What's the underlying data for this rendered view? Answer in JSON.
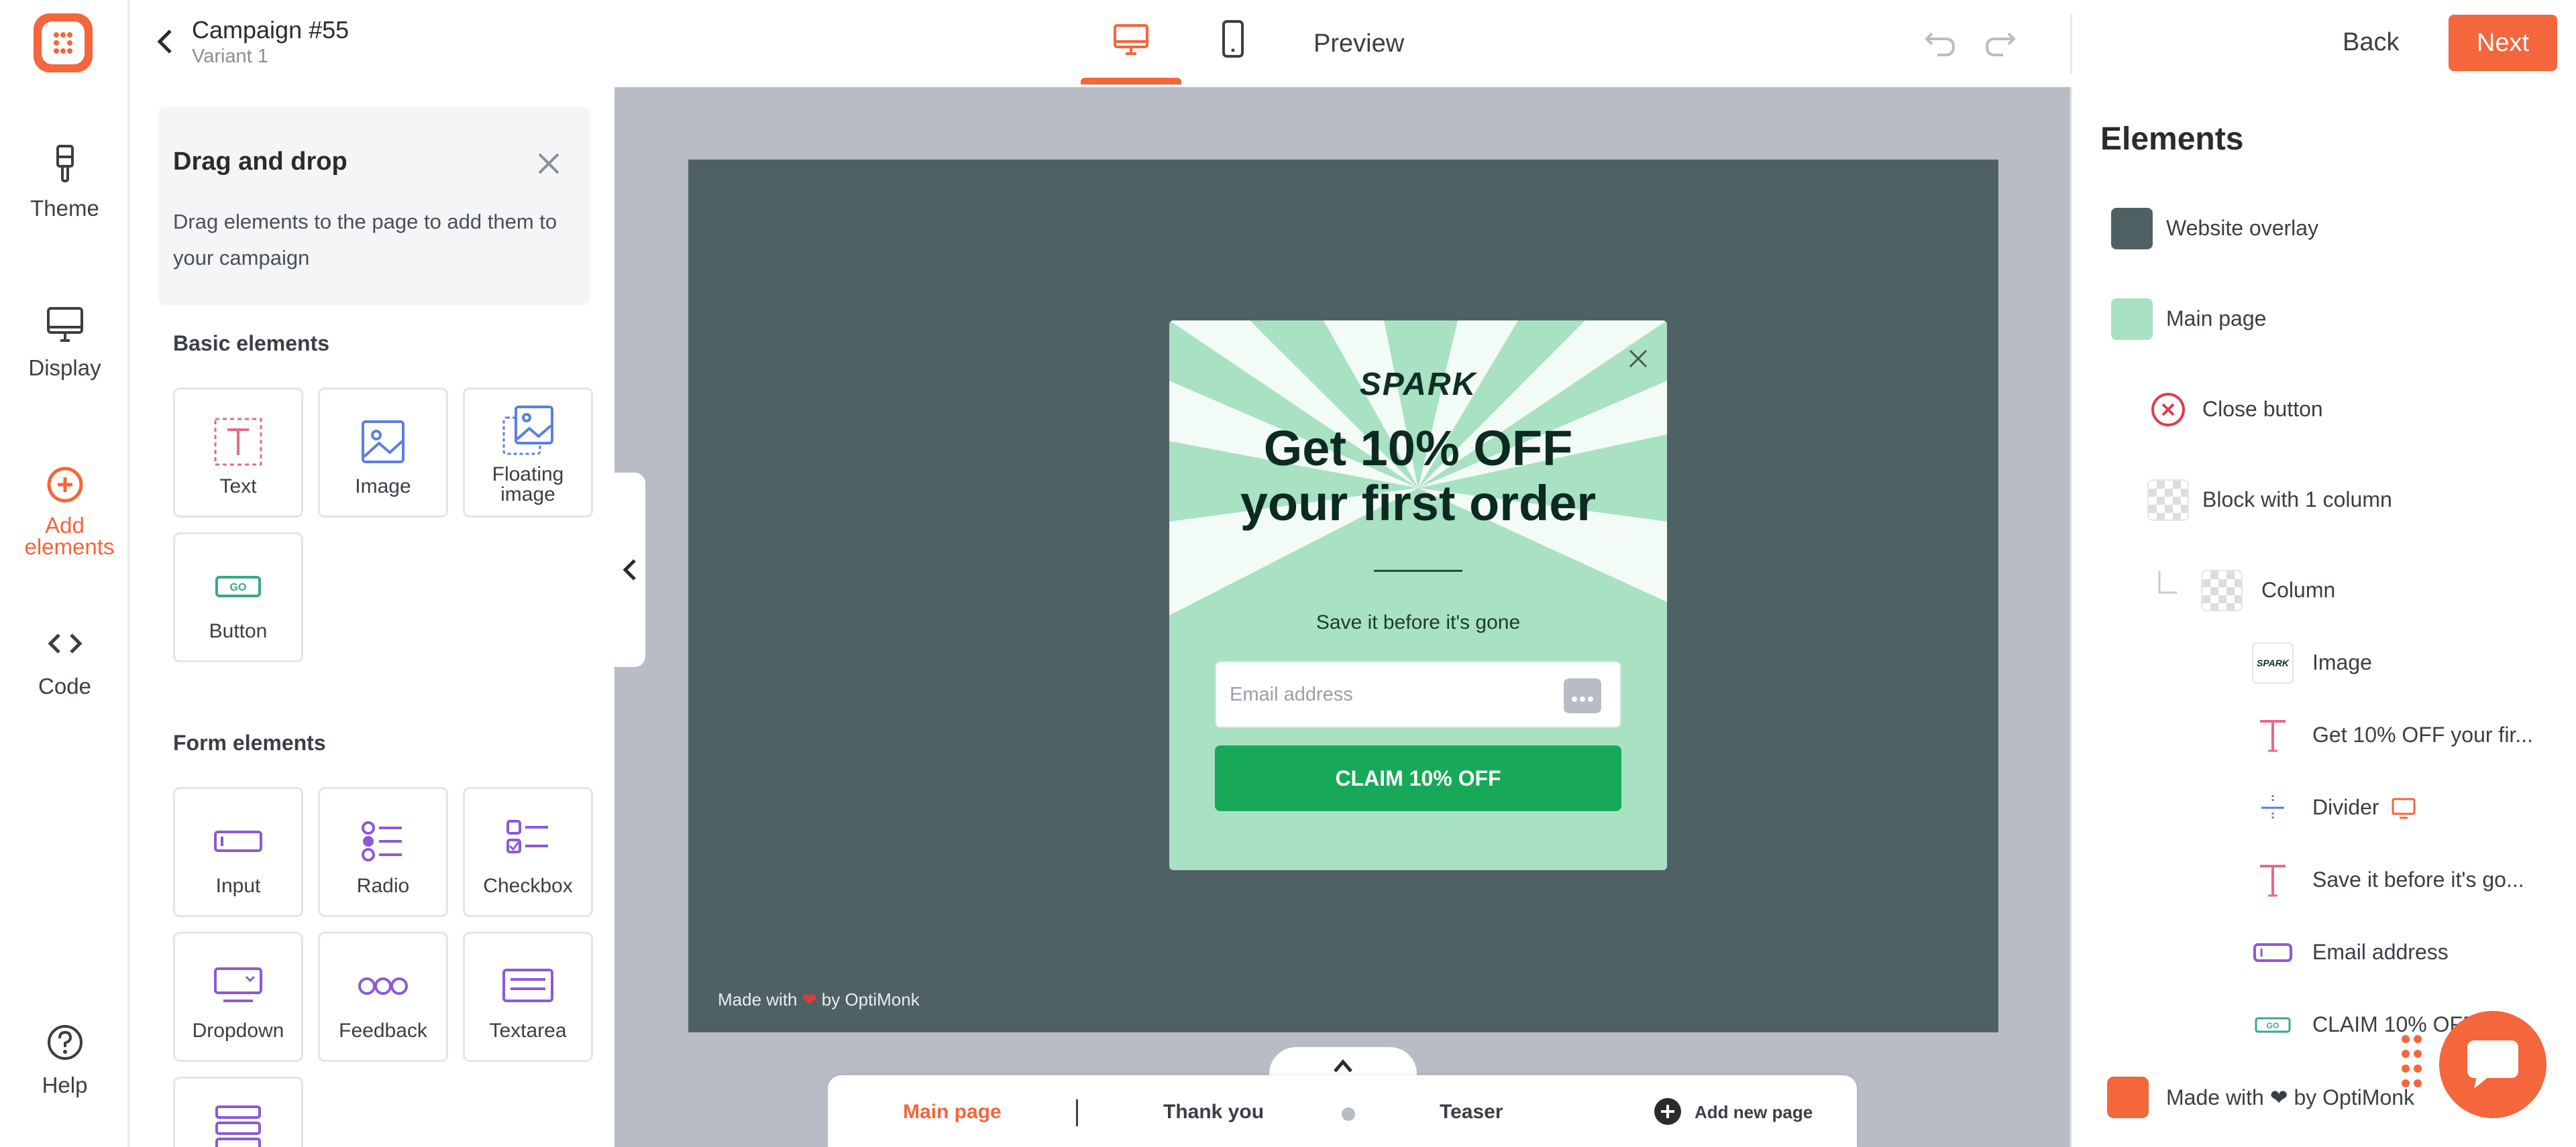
{
  "header": {
    "campaign_title": "Campaign #55",
    "variant": "Variant 1",
    "preview": "Preview",
    "back": "Back",
    "next": "Next"
  },
  "rail": {
    "items": [
      {
        "label": "Theme"
      },
      {
        "label": "Display"
      },
      {
        "label": "Add elements"
      },
      {
        "label": "Code"
      },
      {
        "label": "Help"
      }
    ]
  },
  "panel": {
    "dnd_title": "Drag and drop",
    "dnd_text": "Drag elements to the page to add them to your campaign",
    "basic_title": "Basic elements",
    "basic": [
      "Text",
      "Image",
      "Floating image",
      "Button"
    ],
    "form_title": "Form elements",
    "form": [
      "Input",
      "Radio",
      "Checkbox",
      "Dropdown",
      "Feedback",
      "Textarea"
    ]
  },
  "popup": {
    "brand": "SPARK",
    "headline_line1": "Get 10% OFF",
    "headline_line2": "your first order",
    "subtext": "Save it before it's gone",
    "email_placeholder": "Email address",
    "cta": "CLAIM 10% OFF",
    "made_with_prefix": "Made with",
    "made_with_suffix": "by OptiMonk"
  },
  "pages": {
    "items": [
      "Main page",
      "Thank you",
      "Teaser"
    ],
    "add": "Add new page"
  },
  "layers": {
    "title": "Elements",
    "items": [
      {
        "label": "Website overlay"
      },
      {
        "label": "Main page"
      },
      {
        "label": "Close button"
      },
      {
        "label": "Block with 1 column"
      },
      {
        "label": "Column"
      },
      {
        "label": "Image"
      },
      {
        "label": "Get 10% OFF your fir..."
      },
      {
        "label": "Divider"
      },
      {
        "label": "Save it before it's go..."
      },
      {
        "label": "Email address"
      },
      {
        "label": "CLAIM 10% OFF"
      },
      {
        "label": "Made with ❤ by OptiMonk"
      }
    ],
    "image_thumb": "SPARK"
  },
  "colors": {
    "accent": "#f4663b",
    "overlay": "#506166",
    "popup_bg": "#a9e1c3",
    "cta": "#17a957"
  }
}
